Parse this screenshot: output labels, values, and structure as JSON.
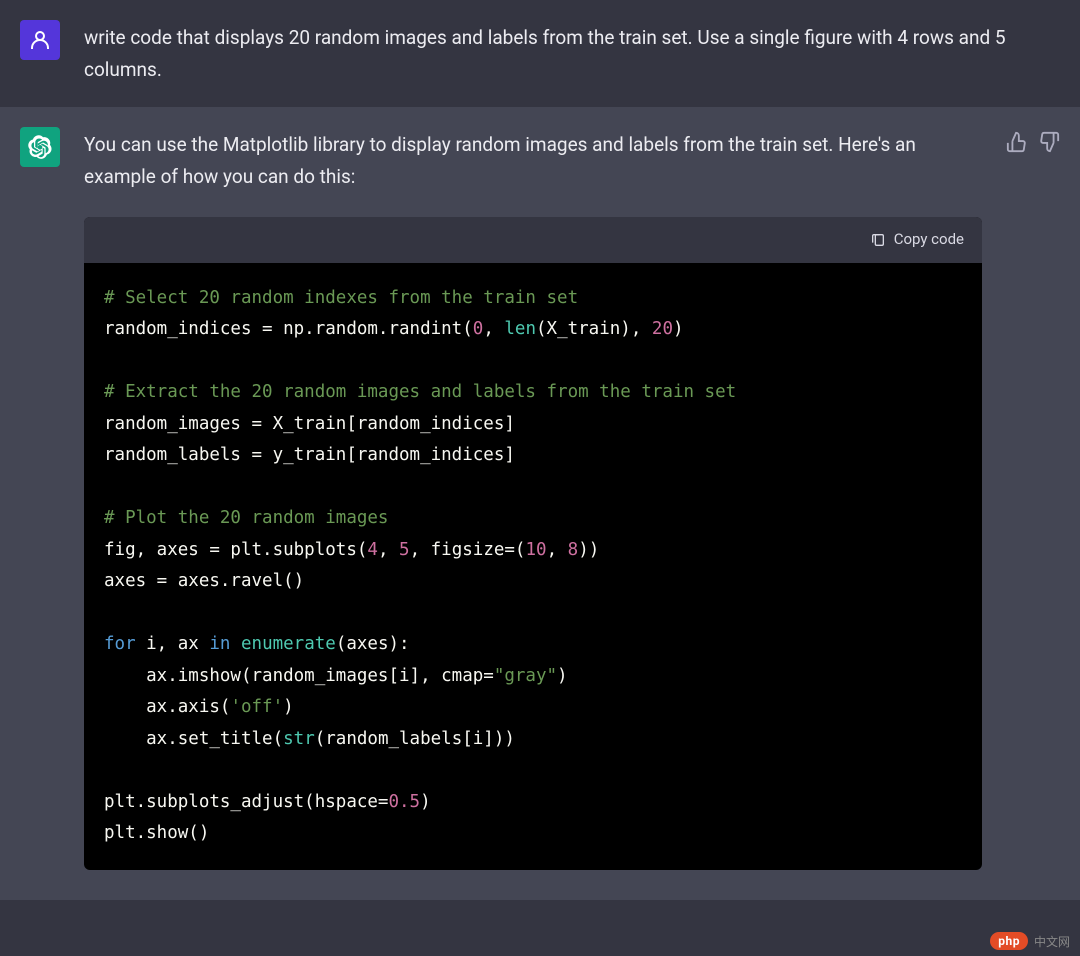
{
  "user": {
    "message": "write code that displays 20 random images and labels from the train set. Use a single figure with 4 rows and 5 columns."
  },
  "assistant": {
    "intro": "You can use the Matplotlib library to display random images and labels from the train set. Here's an example of how you can do this:",
    "copy_label": "Copy code",
    "code": {
      "c1": "# Select 20 random indexes from the train set",
      "l1a": "random_indices = np.random.randint(",
      "l1_zero": "0",
      "l1b": ", ",
      "l1_len": "len",
      "l1c": "(X_train), ",
      "l1_twenty": "20",
      "l1d": ")",
      "c2": "# Extract the 20 random images and labels from the train set",
      "l2": "random_images = X_train[random_indices]",
      "l3": "random_labels = y_train[random_indices]",
      "c3": "# Plot the 20 random images",
      "l4a": "fig, axes = plt.subplots(",
      "l4_four": "4",
      "l4b": ", ",
      "l4_five": "5",
      "l4c": ", figsize=(",
      "l4_ten": "10",
      "l4d": ", ",
      "l4_eight": "8",
      "l4e": "))",
      "l5": "axes = axes.ravel()",
      "l6_for": "for",
      "l6a": " i, ax ",
      "l6_in": "in",
      "l6b": " ",
      "l6_enum": "enumerate",
      "l6c": "(axes):",
      "l7a": "    ax.imshow(random_images[i], cmap=",
      "l7_str": "\"gray\"",
      "l7b": ")",
      "l8a": "    ax.axis(",
      "l8_str": "'off'",
      "l8b": ")",
      "l9a": "    ax.set_title(",
      "l9_str": "str",
      "l9b": "(random_labels[i]))",
      "l10a": "plt.subplots_adjust(hspace=",
      "l10_num": "0.5",
      "l10b": ")",
      "l11": "plt.show()"
    }
  },
  "watermark": {
    "badge": "php",
    "text": "中文网"
  }
}
